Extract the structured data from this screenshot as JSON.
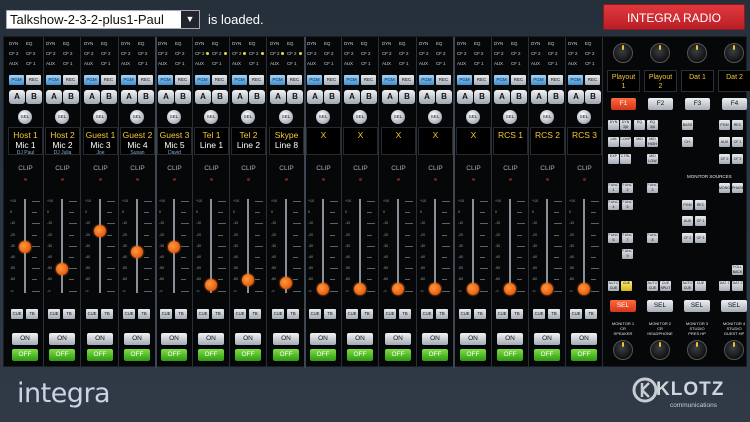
{
  "topbar": {
    "preset_name": "Talkshow-2-3-2-plus1-Paul",
    "loaded_text": "is loaded.",
    "expert_button": "INTEGRA RADIO EXPERT"
  },
  "strip_buttons": {
    "dyn": "DYN",
    "eq": "EQ",
    "cf2": "CF 2",
    "aux": "AUX",
    "cf1": "CF 1",
    "pgm": "PGM",
    "rec": "REC",
    "a": "A",
    "b": "B",
    "sel": "SEL",
    "clip": "CLIP",
    "cue": "CUE",
    "tb": "TB",
    "on": "ON",
    "off": "OFF"
  },
  "scale": [
    "+10",
    "0",
    "-10",
    "-20",
    "-30",
    "-40",
    "-50",
    "-60",
    "-∞"
  ],
  "channels": [
    {
      "line1": "Host 1",
      "line2": "Mic 1",
      "line3": "DJ Paul",
      "fader": 0.55,
      "dots": false
    },
    {
      "line1": "Host 2",
      "line2": "Mic 2",
      "line3": "DJ Julia",
      "fader": 0.29,
      "dots": false
    },
    {
      "line1": "Guest 1",
      "line2": "Mic 3",
      "line3": "Joe",
      "fader": 0.74,
      "dots": false
    },
    {
      "line1": "Guest 2",
      "line2": "Mic 4",
      "line3": "Susan",
      "fader": 0.49,
      "dots": false
    },
    {
      "line1": "Guest 3",
      "line2": "Mic 5",
      "line3": "David",
      "fader": 0.55,
      "dots": false
    },
    {
      "line1": "Tel 1",
      "line2": "Line 1",
      "line3": "",
      "fader": 0.1,
      "dots": true
    },
    {
      "line1": "Tel 2",
      "line2": "Line 2",
      "line3": "",
      "fader": 0.16,
      "dots": true
    },
    {
      "line1": "Skype",
      "line2": "Line 8",
      "line3": "",
      "fader": 0.12,
      "dots": true
    },
    {
      "line1": "X",
      "line2": "",
      "line3": "",
      "fader": 0.05,
      "dots": false
    },
    {
      "line1": "X",
      "line2": "",
      "line3": "",
      "fader": 0.05,
      "dots": false
    },
    {
      "line1": "X",
      "line2": "",
      "line3": "",
      "fader": 0.05,
      "dots": false
    },
    {
      "line1": "X",
      "line2": "",
      "line3": "",
      "fader": 0.05,
      "dots": false
    },
    {
      "line1": "X",
      "line2": "",
      "line3": "",
      "fader": 0.05,
      "dots": false
    },
    {
      "line1": "RCS 1",
      "line2": "",
      "line3": "",
      "fader": 0.05,
      "dots": false
    },
    {
      "line1": "RCS 2",
      "line2": "",
      "line3": "",
      "fader": 0.05,
      "dots": false
    },
    {
      "line1": "RCS 3",
      "line2": "",
      "line3": "",
      "fader": 0.05,
      "dots": false
    }
  ],
  "right_panel": {
    "outputs": [
      {
        "line1": "Playout",
        "line2": "1"
      },
      {
        "line1": "Playout",
        "line2": "2"
      },
      {
        "line1": "Dat 1",
        "line2": ""
      },
      {
        "line1": "Dat 2",
        "line2": ""
      }
    ],
    "function_keys": [
      "F1",
      "F2",
      "F3",
      "F4"
    ],
    "active_function": "F1",
    "grid_left": [
      [
        "DYN",
        "DYN 3|6"
      ],
      [
        "EQ",
        "EQ 3|6"
      ],
      [
        "LIM",
        "COMP"
      ],
      [
        "MID",
        "MID HIGH"
      ],
      [
        "EXP",
        "CTRL"
      ],
      [
        "MID LOW",
        ""
      ]
    ],
    "grid_mid": [
      "BASS",
      "CH."
    ],
    "grid_right": [
      "PGM",
      "REC",
      "AUX",
      "CF 1",
      "CF 2",
      "CF 3"
    ],
    "monitor_sources_title": "MONITOR  SOURCES",
    "func_keys": [
      "FUNC 1",
      "FUNC 2",
      "FUNC 3",
      "FUNC 4",
      "FUNC 5",
      "FUNC 6",
      "FUNC 7",
      "FUNC 8",
      "FUNC 9"
    ],
    "monitor_sources": [
      "MONO",
      "PHASE",
      "PGM",
      "REC",
      "AUX",
      "CF 1",
      "CF 2",
      "CF 3",
      "FOLL BACK",
      "DAT 1",
      "DAT 2"
    ],
    "cue_row": [
      "AUTO CUE",
      "CUE",
      "AUTO CUE",
      "CUE SPLIT",
      "AUTO CUE",
      "CUE",
      "AUTO CUE",
      "CUE SPLIT"
    ],
    "sel_labels": [
      "SEL",
      "SEL",
      "SEL",
      "SEL"
    ],
    "monitor_captions": [
      {
        "a": "MONITOR 1",
        "b": "CR",
        "c": "SPEAKER"
      },
      {
        "a": "MONITOR 2",
        "b": "CR",
        "c": "HEADPHONE"
      },
      {
        "a": "MONITOR 3",
        "b": "STUDIO",
        "c": "PRES HP"
      },
      {
        "a": "MONITOR 4",
        "b": "STUDIO",
        "c": "GUEST HP"
      }
    ]
  },
  "footer": {
    "brand": "integra",
    "logo_text": "KLOTZ",
    "logo_sub": "communications"
  },
  "colors": {
    "accent_red": "#d3361a",
    "label_yellow": "#f3c838",
    "off_green": "#3fae1d",
    "fader_orange": "#e85c0e"
  }
}
